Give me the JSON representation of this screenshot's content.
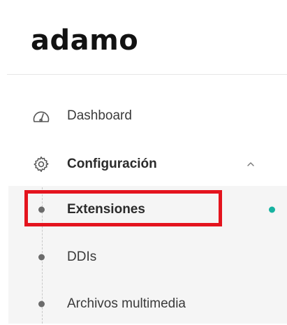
{
  "brand": {
    "logo_text": "adamo"
  },
  "nav": {
    "dashboard": {
      "label": "Dashboard",
      "icon": "gauge-icon"
    },
    "configuracion": {
      "label": "Configuración",
      "icon": "gear-icon",
      "expanded": true,
      "chevron": "chevron-up-icon",
      "children": [
        {
          "label": "Extensiones",
          "active": true
        },
        {
          "label": "DDIs",
          "active": false
        },
        {
          "label": "Archivos multimedia",
          "active": false
        }
      ]
    }
  },
  "colors": {
    "active_indicator": "#17b2a0",
    "highlight_border": "#e4141e",
    "submenu_bg": "#f5f5f5"
  }
}
